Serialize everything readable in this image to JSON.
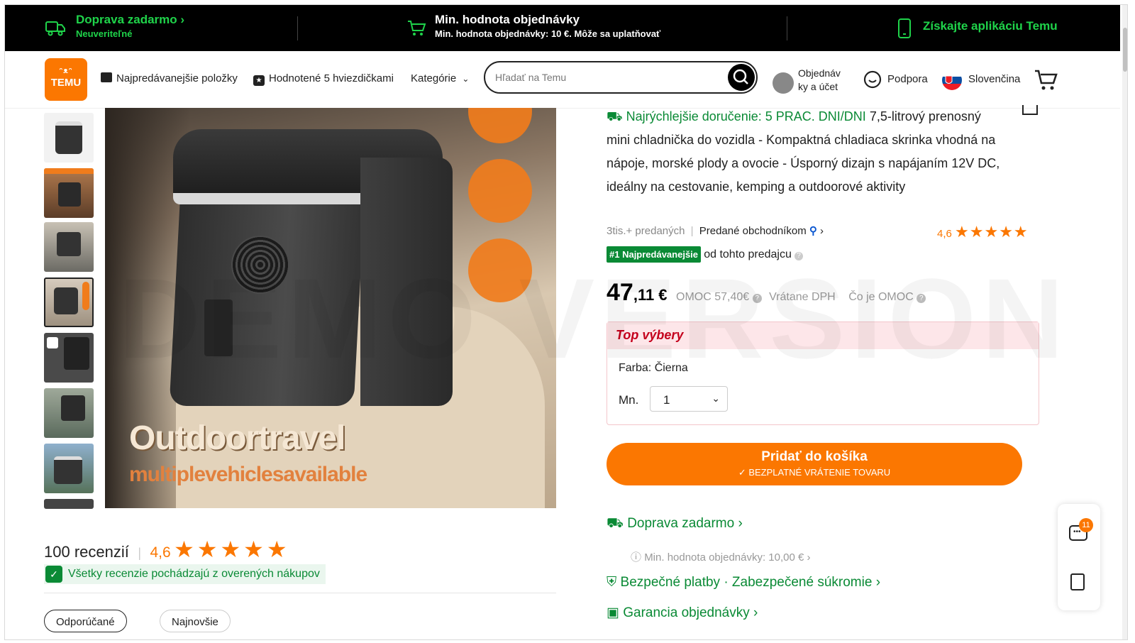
{
  "banner": {
    "free_shipping_title": "Doprava zadarmo",
    "free_shipping_sub": "Neuveriteľné",
    "min_order_title": "Min. hodnota objednávky",
    "min_order_sub": "Min. hodnota objednávky: 10 €. Môže sa uplatňovať",
    "app": "Získajte aplikáciu Temu"
  },
  "header": {
    "logo_top": "ᵔᴥᵔ",
    "logo_bottom": "TEMU",
    "nav_bestsellers": "Najpredávanejšie položky",
    "nav_rated": "Hodnotené 5 hviezdičkami",
    "nav_categories": "Kategórie",
    "search_placeholder": "Hľadať na Temu",
    "orders_line1": "Objednáv",
    "orders_line2": "ky a účet",
    "support": "Podpora",
    "language": "Slovenčina"
  },
  "gallery": {
    "overlay_big": "Outdoortravel",
    "overlay_small": "multiplevehiclesavailable"
  },
  "product": {
    "delivery_badge": "Najrýchlejšie doručenie: 5 PRAC. DNI/DNI",
    "title": "7,5-litrový prenosný mini chladnička do vozidla - Kompaktná chladiaca skrinka vhodná na nápoje, morské plody a ovocie - Úsporný dizajn s napájaním 12V DC, ideálny na cestovanie, kemping a outdoorové aktivity",
    "sold": "3tis.+ predaných",
    "sold_by": "Predané obchodníkom",
    "rating": "4,6",
    "best_badge": "#1 Najpredávanejšie",
    "best_from": "od tohto predajcu",
    "price_int": "47",
    "price_dec": ",11 €",
    "omoc": "OMOC 57,40€",
    "vat": "Vrátane DPH",
    "omoc_what": "Čo je OMOC",
    "top_picks": "Top výbery",
    "color_label": "Farba: Čierna",
    "qty_label": "Mn.",
    "qty_value": "1",
    "add_to_cart": "Pridať do košíka",
    "free_return": "✓ BEZPLATNÉ VRÁTENIE TOVARU",
    "shipping": "Doprava zadarmo",
    "shipping_min": "Min. hodnota objednávky: 10,00 €",
    "secure": "Bezpečné platby · Zabezpečené súkromie",
    "guarantee": "Garancia objednávky"
  },
  "reviews": {
    "count": "100 recenzií",
    "rating": "4,6",
    "verified": "Všetky recenzie pochádzajú z overených nákupov",
    "tab_recommended": "Odporúčané",
    "tab_newest": "Najnovšie"
  },
  "side": {
    "chat_badge": "11"
  },
  "watermark": "DEMO VERSION",
  "colors": {
    "brand": "#fb7701",
    "green": "#0a8a35",
    "banner_green": "#1fd34a"
  }
}
